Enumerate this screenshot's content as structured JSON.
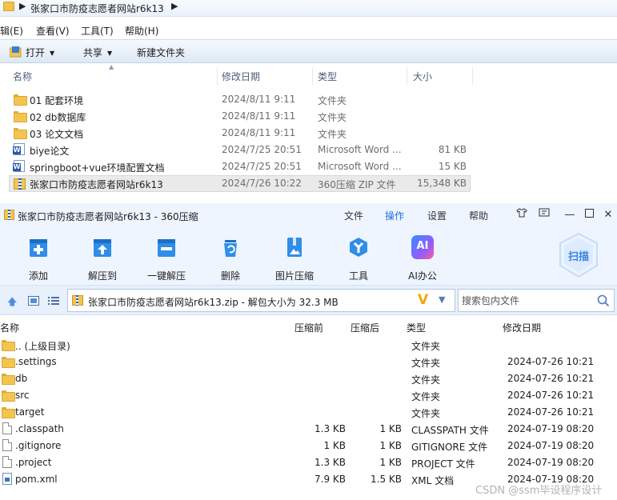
{
  "explorer": {
    "breadcrumb": "张家口市防疫志愿者网站r6k13",
    "menu": [
      "辑(E)",
      "查看(V)",
      "工具(T)",
      "帮助(H)"
    ],
    "commands": {
      "open": "打开",
      "share": "共享",
      "new_folder": "新建文件夹"
    },
    "columns": {
      "name": "名称",
      "date": "修改日期",
      "type": "类型",
      "size": "大小"
    },
    "rows": [
      {
        "name": "01 配套环境",
        "date": "2024/8/11 9:11",
        "type": "文件夹",
        "size": "",
        "icon": "folder-icon"
      },
      {
        "name": "02 db数据库",
        "date": "2024/8/11 9:11",
        "type": "文件夹",
        "size": "",
        "icon": "folder-icon"
      },
      {
        "name": "03 论文文档",
        "date": "2024/8/11 9:11",
        "type": "文件夹",
        "size": "",
        "icon": "folder-icon"
      },
      {
        "name": "biye论文",
        "date": "2024/7/25 20:51",
        "type": "Microsoft Word ...",
        "size": "81 KB",
        "icon": "word-doc-icon"
      },
      {
        "name": "springboot+vue环境配置文档",
        "date": "2024/7/25 20:51",
        "type": "Microsoft Word ...",
        "size": "15 KB",
        "icon": "word-doc-icon"
      },
      {
        "name": "张家口市防疫志愿者网站r6k13",
        "date": "2024/7/26 10:22",
        "type": "360压缩 ZIP 文件",
        "size": "15,348 KB",
        "icon": "zip-archive-icon"
      }
    ]
  },
  "zip": {
    "title": "张家口市防疫志愿者网站r6k13 - 360压缩",
    "menu": {
      "file": "文件",
      "operate": "操作",
      "settings": "设置",
      "help": "帮助"
    },
    "tools": [
      {
        "label": "添加",
        "icon": "add-icon"
      },
      {
        "label": "解压到",
        "icon": "extract-to-icon"
      },
      {
        "label": "一键解压",
        "icon": "one-click-extract-icon"
      },
      {
        "label": "删除",
        "icon": "delete-icon"
      },
      {
        "label": "图片压缩",
        "icon": "image-compress-icon"
      },
      {
        "label": "工具",
        "icon": "tools-icon"
      },
      {
        "label": "AI办公",
        "icon": "ai-office-icon"
      }
    ],
    "ai_badge": "AI",
    "scan_label": "扫描",
    "path": "张家口市防疫志愿者网站r6k13.zip - 解包大小为 32.3 MB",
    "search_placeholder": "搜索包内文件",
    "columns": {
      "name": "名称",
      "packed": "压缩前",
      "compressed": "压缩后",
      "type": "类型",
      "date": "修改日期"
    },
    "rows": [
      {
        "name": ".. (上级目录)",
        "packed": "",
        "compressed": "",
        "type": "文件夹",
        "date": "",
        "icon": "folder-icon"
      },
      {
        "name": ".settings",
        "packed": "",
        "compressed": "",
        "type": "文件夹",
        "date": "2024-07-26 10:21",
        "icon": "folder-icon"
      },
      {
        "name": "db",
        "packed": "",
        "compressed": "",
        "type": "文件夹",
        "date": "2024-07-26 10:21",
        "icon": "folder-icon"
      },
      {
        "name": "src",
        "packed": "",
        "compressed": "",
        "type": "文件夹",
        "date": "2024-07-26 10:21",
        "icon": "folder-icon"
      },
      {
        "name": "target",
        "packed": "",
        "compressed": "",
        "type": "文件夹",
        "date": "2024-07-26 10:21",
        "icon": "folder-icon"
      },
      {
        "name": ".classpath",
        "packed": "1.3 KB",
        "compressed": "1 KB",
        "type": "CLASSPATH 文件",
        "date": "2024-07-19 08:20",
        "icon": "file-icon"
      },
      {
        "name": ".gitignore",
        "packed": "1 KB",
        "compressed": "1 KB",
        "type": "GITIGNORE 文件",
        "date": "2024-07-19 08:20",
        "icon": "file-icon"
      },
      {
        "name": ".project",
        "packed": "1.3 KB",
        "compressed": "1 KB",
        "type": "PROJECT 文件",
        "date": "2024-07-19 08:20",
        "icon": "file-icon"
      },
      {
        "name": "pom.xml",
        "packed": "7.9 KB",
        "compressed": "1.5 KB",
        "type": "XML 文档",
        "date": "2024-07-19 08:20",
        "icon": "xml-file-icon"
      }
    ]
  },
  "watermark": "CSDN @ssm毕设程序设计"
}
